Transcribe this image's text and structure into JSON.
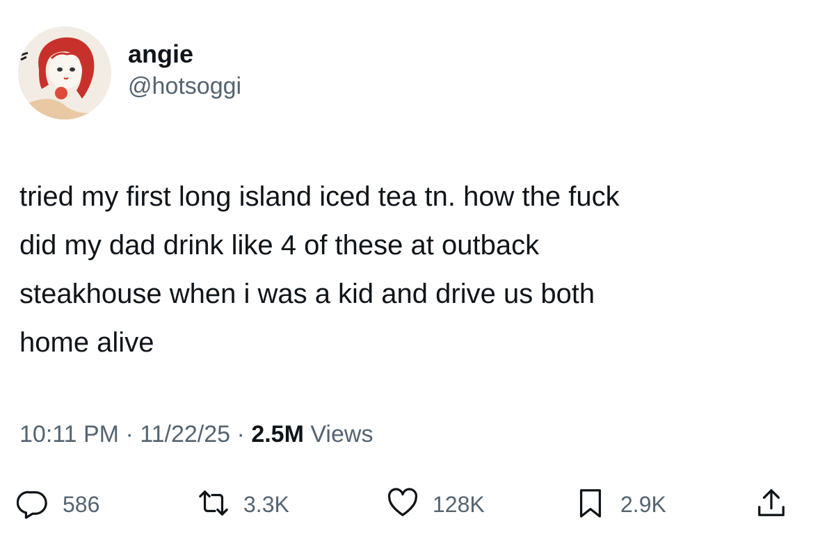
{
  "author": {
    "display_name": "angie",
    "handle": "@hotsoggi"
  },
  "tweet": {
    "text": "tried my first long island iced tea tn. how the fuck\ndid my dad drink like 4 of these at outback\nsteakhouse when i was a kid and drive us both\nhome alive"
  },
  "meta": {
    "time": "10:11 PM",
    "date": "11/22/25",
    "views_count": "2.5M",
    "views_label": "Views",
    "separator": "·"
  },
  "actions": {
    "reply_count": "586",
    "repost_count": "3.3K",
    "like_count": "128K",
    "bookmark_count": "2.9K"
  },
  "icons": [
    "reply-icon",
    "repost-icon",
    "like-icon",
    "bookmark-icon",
    "share-icon"
  ],
  "colors": {
    "text": "#0f1419",
    "secondary": "#536471",
    "avatar_red": "#c8312b"
  }
}
